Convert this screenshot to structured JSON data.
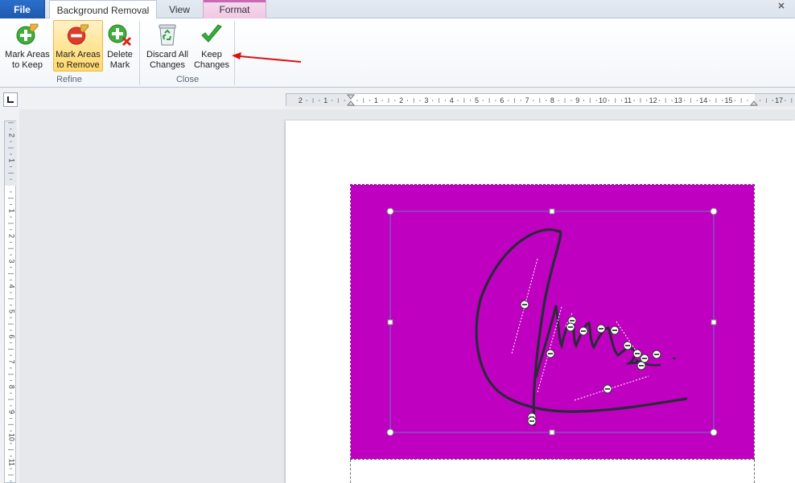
{
  "tabs": {
    "file": "File",
    "background_removal": "Background Removal",
    "view": "View",
    "format": "Format"
  },
  "ribbon": {
    "refine": {
      "group_label": "Refine",
      "mark_keep": [
        "Mark Areas",
        "to Keep"
      ],
      "mark_remove": [
        "Mark Areas",
        "to Remove"
      ],
      "delete_mark": [
        "Delete",
        "Mark"
      ]
    },
    "close": {
      "group_label": "Close",
      "discard": [
        "Discard All",
        "Changes"
      ],
      "keep_changes": [
        "Keep",
        "Changes"
      ]
    }
  },
  "ruler": {
    "top_labels": [
      "2",
      "1",
      "1",
      "2",
      "3",
      "4",
      "5",
      "6",
      "7",
      "8",
      "9",
      "10",
      "11",
      "12",
      "13",
      "14",
      "15",
      "17"
    ],
    "left_labels": [
      "2",
      "1",
      "1",
      "2",
      "3",
      "4",
      "5",
      "6",
      "7",
      "8",
      "9",
      "10",
      "11"
    ]
  },
  "colors": {
    "background_fill": "#c000c0",
    "arrow": "#e01010",
    "selected_button": "#ffd96a"
  },
  "icons": {
    "mark_keep": "green-plus-pencil-icon",
    "mark_remove": "red-minus-pencil-icon",
    "delete_mark": "green-plus-red-x-icon",
    "discard": "recycle-bin-icon",
    "keep_changes": "green-checkmark-icon"
  }
}
